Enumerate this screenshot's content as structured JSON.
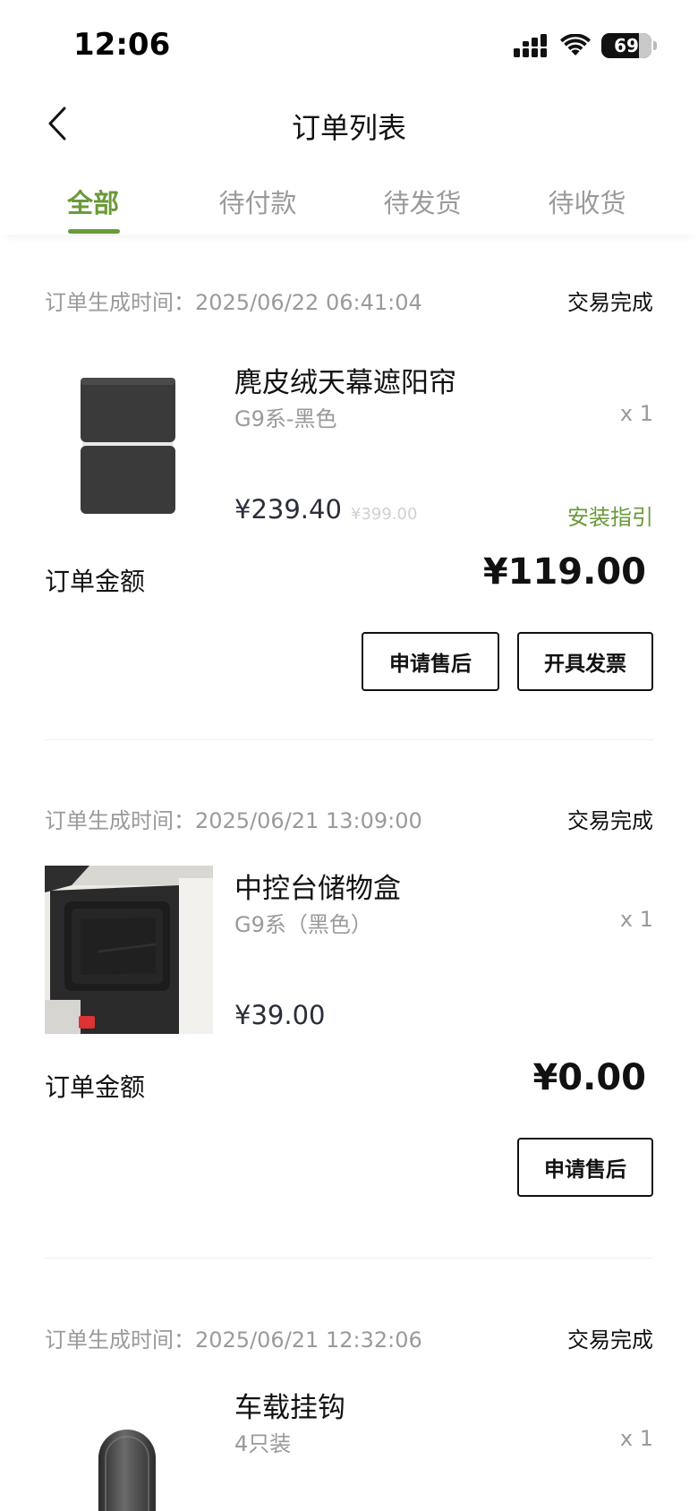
{
  "status_bar": {
    "time": "12:06",
    "battery": "69"
  },
  "header": {
    "title": "订单列表"
  },
  "tabs": [
    {
      "label": "全部",
      "active": true
    },
    {
      "label": "待付款",
      "active": false
    },
    {
      "label": "待发货",
      "active": false
    },
    {
      "label": "待收货",
      "active": false
    }
  ],
  "colors": {
    "accent": "#6a9a3a",
    "muted_text": "#9a9a9a",
    "primary_text": "#111111",
    "price_text": "#2a2d3a"
  },
  "orders": [
    {
      "time": "订单生成时间：2025/06/22 06:41:04",
      "status": "交易完成",
      "product": {
        "name": "麂皮绒天幕遮阳帘",
        "spec": "G9系-黑色",
        "qty": "x 1",
        "price": "¥239.40",
        "original_price": "¥399.00",
        "link": "安装指引"
      },
      "amount_label": "订单金额",
      "amount": "¥119.00",
      "actions": [
        "申请售后",
        "开具发票"
      ]
    },
    {
      "time": "订单生成时间：2025/06/21 13:09:00",
      "status": "交易完成",
      "product": {
        "name": "中控台储物盒",
        "spec": "G9系（黑色）",
        "qty": "x 1",
        "price": "¥39.00"
      },
      "amount_label": "订单金额",
      "amount": "¥0.00",
      "actions": [
        "申请售后"
      ]
    },
    {
      "time": "订单生成时间：2025/06/21 12:32:06",
      "status": "交易完成",
      "product": {
        "name": "车载挂钩",
        "spec": "4只装",
        "qty": "x 1"
      }
    }
  ]
}
